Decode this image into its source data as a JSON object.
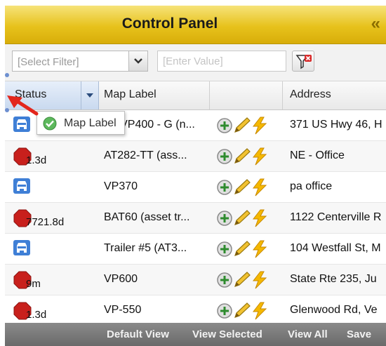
{
  "title": "Control Panel",
  "filter": {
    "select_value": "[Select Filter]",
    "value_placeholder": "[Enter Value]"
  },
  "columns": {
    "status": "Status",
    "label": "Map Label",
    "actions": "",
    "address": "Address"
  },
  "tooltip": {
    "text": "Map Label"
  },
  "rows": [
    {
      "status_icon": "vehicle-moving",
      "duration": "",
      "label": "7 - VP400 - G (n...",
      "address": "371 US Hwy 46, H"
    },
    {
      "status_icon": "stop",
      "duration": "1.3d",
      "label": "AT282-TT (ass...",
      "address": "NE - Office"
    },
    {
      "status_icon": "vehicle-moving",
      "duration": "",
      "label": "VP370",
      "address": "pa office"
    },
    {
      "status_icon": "stop",
      "duration": "7721.8d",
      "label": "BAT60 (asset tr...",
      "address": "1122 Centerville R"
    },
    {
      "status_icon": "vehicle-moving",
      "duration": "",
      "label": "Trailer #5 (AT3...",
      "address": "104 Westfall St, M"
    },
    {
      "status_icon": "stop",
      "duration": "9m",
      "label": "VP600",
      "address": "State Rte 235, Ju"
    },
    {
      "status_icon": "stop",
      "duration": "1.3d",
      "label": "VP-550",
      "address": "Glenwood Rd, Ve"
    }
  ],
  "footer": {
    "default_view": "Default View",
    "view_selected": "View Selected",
    "view_all": "View All",
    "save": "Save"
  },
  "colors": {
    "title_bar": "#e7c21c",
    "vehicle_icon": "#3f7fd6",
    "stop_icon": "#c8201c",
    "footer": "#7a7a7a"
  }
}
